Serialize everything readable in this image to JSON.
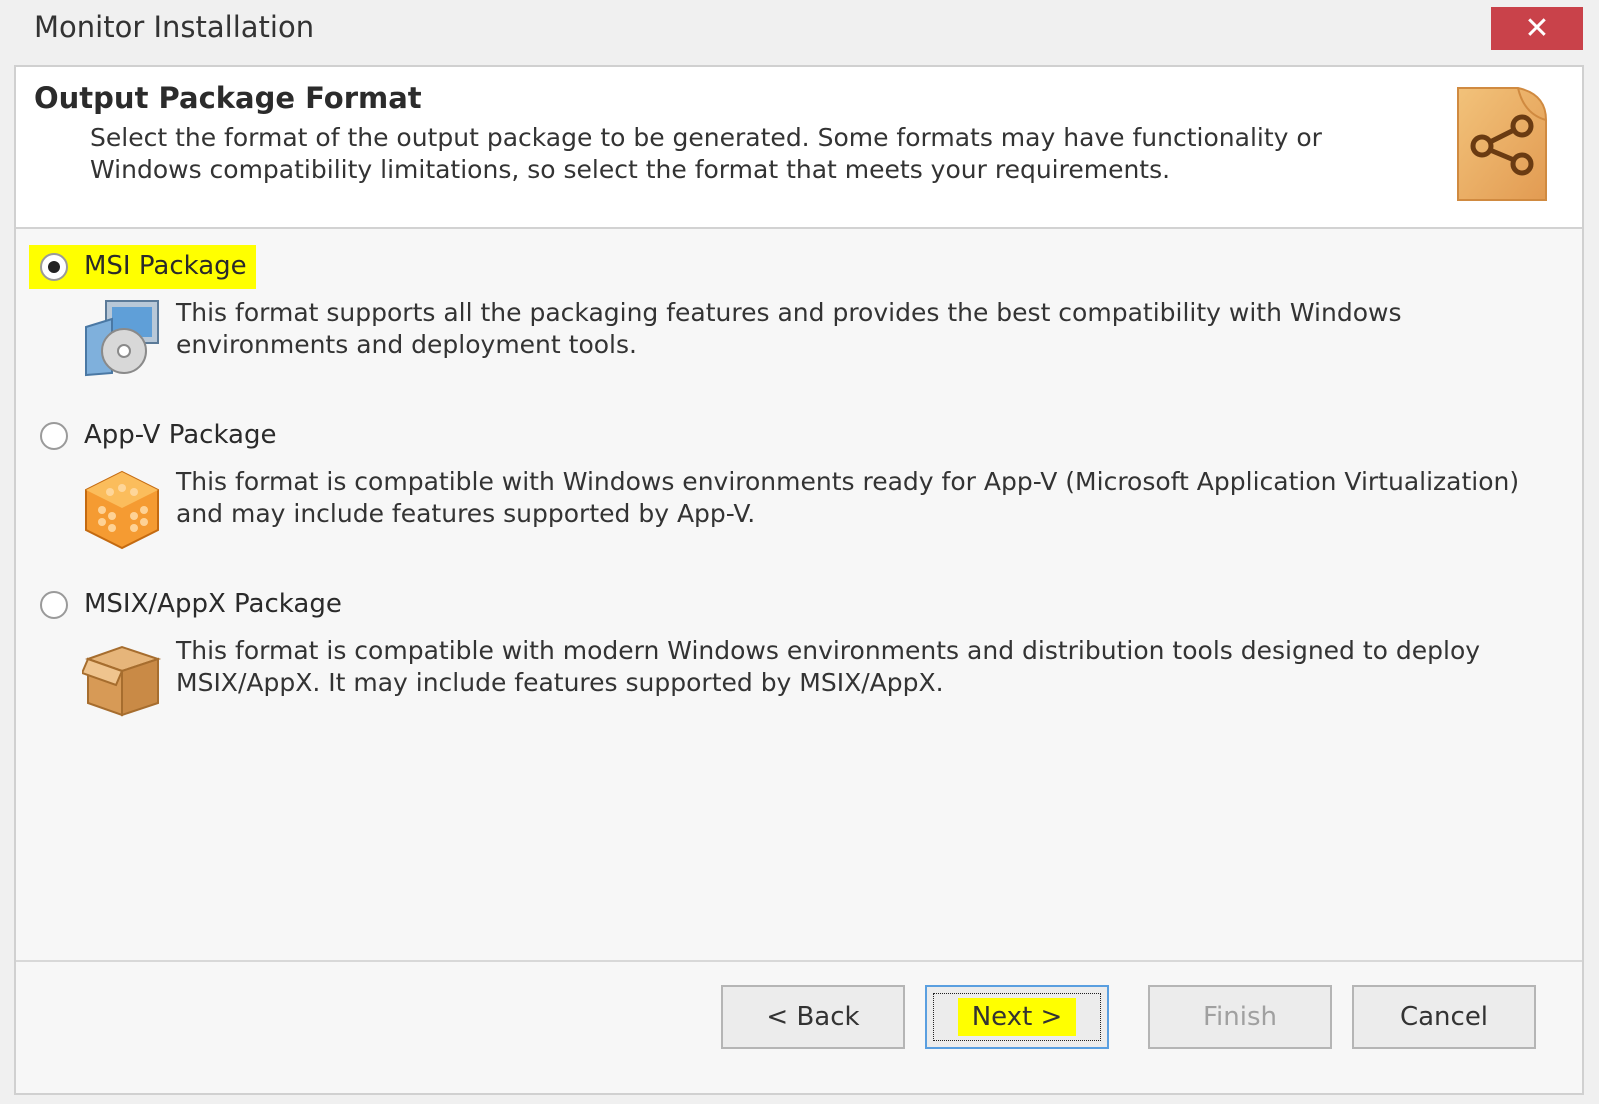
{
  "window": {
    "title": "Monitor Installation",
    "close_label": "✕"
  },
  "header": {
    "title": "Output Package Format",
    "description": "Select the format of the output package to be generated. Some formats may have functionality or Windows compatibility limitations, so select the format that meets your requirements."
  },
  "options": [
    {
      "label": "MSI Package",
      "description": "This format supports all the packaging features and provides the best compatibility with Windows environments and deployment tools.",
      "selected": true,
      "icon": "msi-package-icon"
    },
    {
      "label": "App-V Package",
      "description": "This format is compatible with Windows environments ready for App-V (Microsoft Application Virtualization) and may include features supported by App-V.",
      "selected": false,
      "icon": "appv-package-icon"
    },
    {
      "label": "MSIX/AppX Package",
      "description": "This format is compatible with modern Windows environments and distribution tools designed to deploy MSIX/AppX. It may include features supported by MSIX/AppX.",
      "selected": false,
      "icon": "msix-box-icon"
    }
  ],
  "buttons": {
    "back": "< Back",
    "next": "Next >",
    "finish": "Finish",
    "cancel": "Cancel"
  },
  "colors": {
    "highlight": "#ffff00",
    "close": "#c9424a",
    "header_icon": "#e8a860"
  }
}
